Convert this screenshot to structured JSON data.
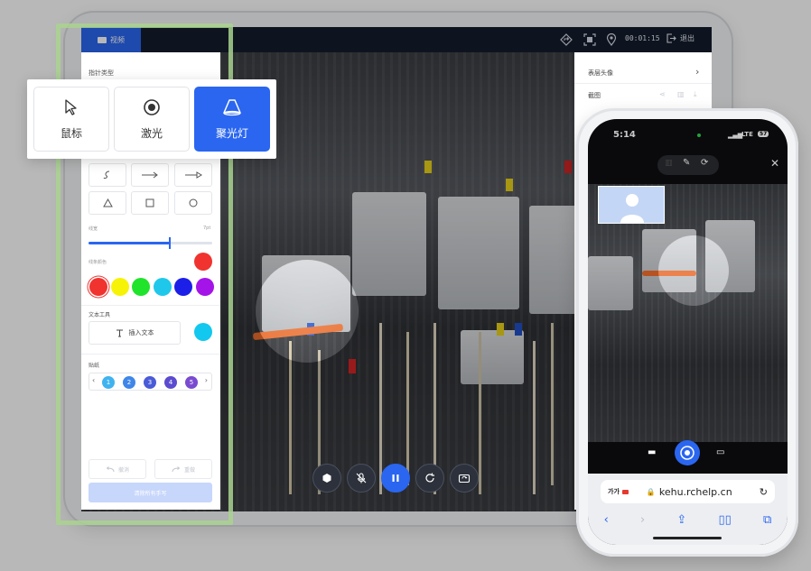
{
  "tablet": {
    "tab_video_label": "视频",
    "timer": "00:01:15",
    "exit_label": "退出"
  },
  "left_panel": {
    "pointer_type_title": "指针类型",
    "line_width_label": "线宽",
    "line_width_value": "7pt",
    "line_width_fraction": 0.66,
    "line_color_label": "线条颜色",
    "selected_color": "#f0332f",
    "colors": [
      "#f0332f",
      "#f7f306",
      "#20e32c",
      "#1fc8ea",
      "#1c1fe8",
      "#a414e8"
    ],
    "text_tool_title": "文本工具",
    "insert_text_label": "插入文本",
    "text_color": "#12c8ee",
    "sticker_title": "贴纸",
    "stickers": [
      "1",
      "2",
      "3",
      "4",
      "5"
    ],
    "undo_label": "撤消",
    "redo_label": "重做",
    "clear_label": "清除所有手写"
  },
  "pointer_popup": {
    "mouse_label": "鼠标",
    "laser_label": "激光",
    "spotlight_label": "聚光灯"
  },
  "right_panel": {
    "row1": "表层头像",
    "row2": "截图"
  },
  "phone": {
    "time": "5:14",
    "signal": "LTE",
    "battery": "57",
    "url_prefix": "가가",
    "url": "kehu.rchelp.cn"
  },
  "accent_color": "#2a66f0"
}
